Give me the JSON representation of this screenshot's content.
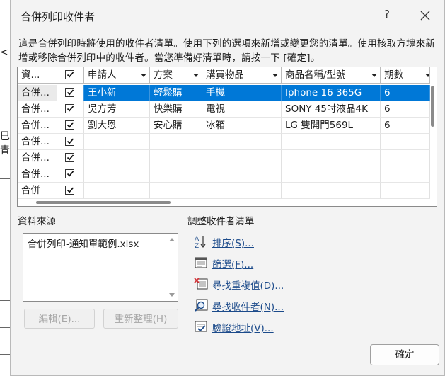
{
  "dialog": {
    "title": "合併列印收件者",
    "help_label": "?",
    "intro": "這是合併列印時將使用的收件者清單。使用下列的選項來新增或變更您的清單。使用核取方塊來新增或移除合併列印中的收件者。當您準備好清單時，請按一下 [確定]。"
  },
  "table": {
    "columns": [
      "資...",
      "",
      "申請人",
      "方案",
      "購買物品",
      "商品名稱/型號",
      "期數"
    ],
    "rows": [
      {
        "source": "合併...",
        "checked": true,
        "applicant": "王小新",
        "plan": "輕鬆購",
        "item": "手機",
        "model": "Iphone 16 365G",
        "periods": "6",
        "selected": true
      },
      {
        "source": "合併...",
        "checked": true,
        "applicant": "吳方芳",
        "plan": "快樂購",
        "item": "電視",
        "model": "SONY 45吋液晶4K",
        "periods": "6",
        "selected": false
      },
      {
        "source": "合併...",
        "checked": true,
        "applicant": "劉大恩",
        "plan": "安心購",
        "item": "冰箱",
        "model": "LG 雙開門569L",
        "periods": "6",
        "selected": false
      },
      {
        "source": "合併...",
        "checked": true,
        "applicant": "",
        "plan": "",
        "item": "",
        "model": "",
        "periods": "",
        "selected": false
      },
      {
        "source": "合併...",
        "checked": true,
        "applicant": "",
        "plan": "",
        "item": "",
        "model": "",
        "periods": "",
        "selected": false
      },
      {
        "source": "合併...",
        "checked": true,
        "applicant": "",
        "plan": "",
        "item": "",
        "model": "",
        "periods": "",
        "selected": false
      },
      {
        "source": "合併",
        "checked": true,
        "applicant": "",
        "plan": "",
        "item": "",
        "model": "",
        "periods": "",
        "selected": false
      }
    ]
  },
  "data_source": {
    "label": "資料來源",
    "file": "合併列印-通知單範例.xlsx",
    "edit_button": "編輯(E)...",
    "refresh_button": "重新整理(H)"
  },
  "refine": {
    "label": "調整收件者清單",
    "links": [
      {
        "label": "排序(S)...",
        "icon": "sort-icon"
      },
      {
        "label": "篩選(F)...",
        "icon": "filter-icon"
      },
      {
        "label": "尋找重複值(D)...",
        "icon": "find-duplicates-icon"
      },
      {
        "label": "尋找收件者(N)...",
        "icon": "find-recipient-icon"
      },
      {
        "label": "驗證地址(V)...",
        "icon": "validate-address-icon"
      }
    ]
  },
  "ok_button": "確定",
  "colors": {
    "selection": "#0078d7",
    "link": "#1b4a8a",
    "dialog_bg": "#f3f3f3"
  }
}
